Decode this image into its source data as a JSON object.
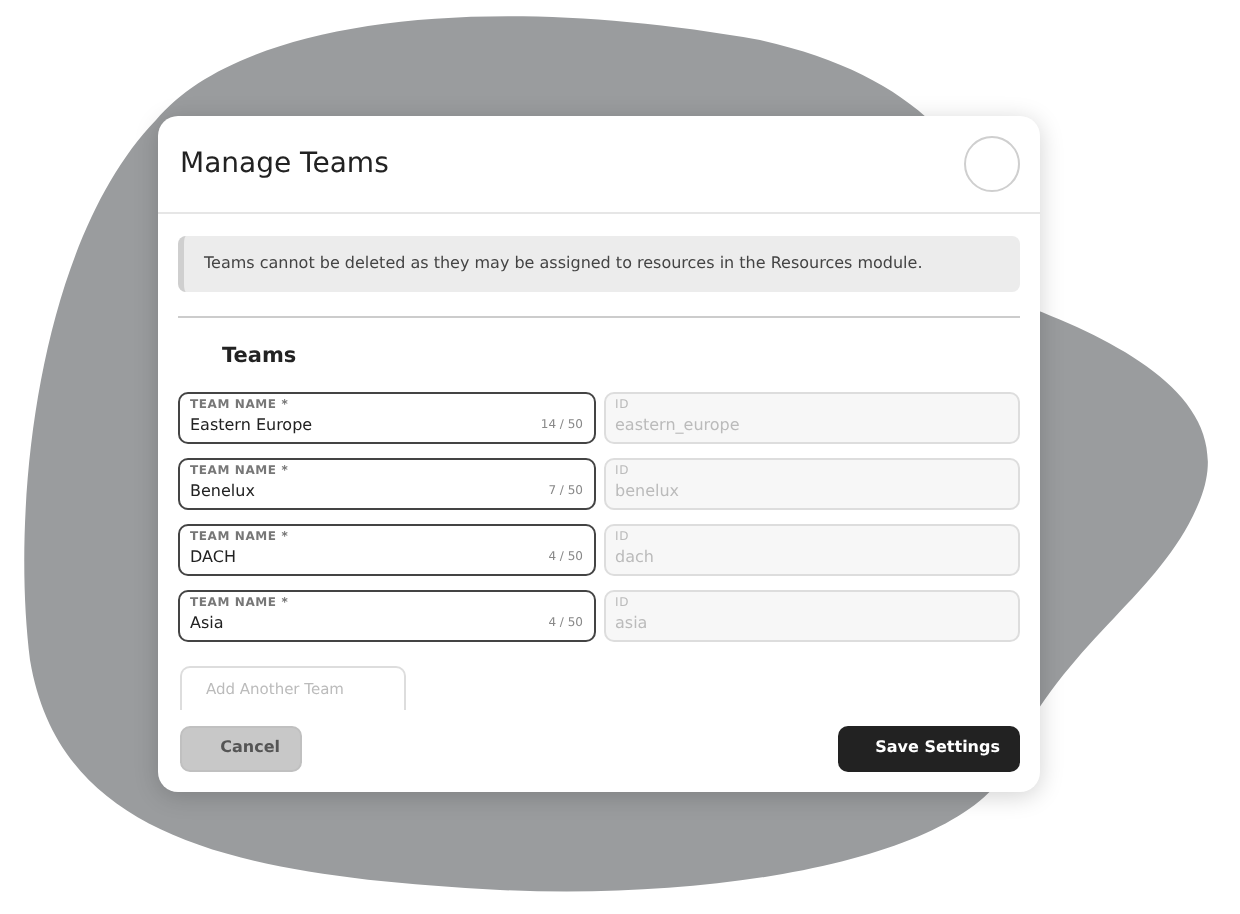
{
  "dialog": {
    "title": "Manage Teams",
    "notice": "Teams cannot be deleted as they may be assigned to resources in the Resources module.",
    "section_title": "Teams",
    "teams": [
      {
        "name_label": "TEAM NAME *",
        "name": "Eastern Europe",
        "counter": "14 / 50",
        "id_label": "ID",
        "id": "eastern_europe",
        "id_disabled": true
      },
      {
        "name_label": "TEAM NAME *",
        "name": "Benelux",
        "counter": "7 / 50",
        "id_label": "ID",
        "id": "benelux",
        "id_disabled": true
      },
      {
        "name_label": "TEAM NAME *",
        "name": "DACH",
        "counter": "4 / 50",
        "id_label": "ID",
        "id": "dach",
        "id_disabled": true
      },
      {
        "name_label": "TEAM NAME *",
        "name": "Asia",
        "counter": "4 / 50",
        "id_label": "ID",
        "id": "asia",
        "id_disabled": true
      }
    ],
    "add_button": {
      "label": "Add Another Team",
      "disabled": true
    },
    "buttons": [
      {
        "label": "Cancel",
        "kind": "secondary"
      },
      {
        "label": "Save Settings",
        "kind": "primary"
      }
    ]
  }
}
